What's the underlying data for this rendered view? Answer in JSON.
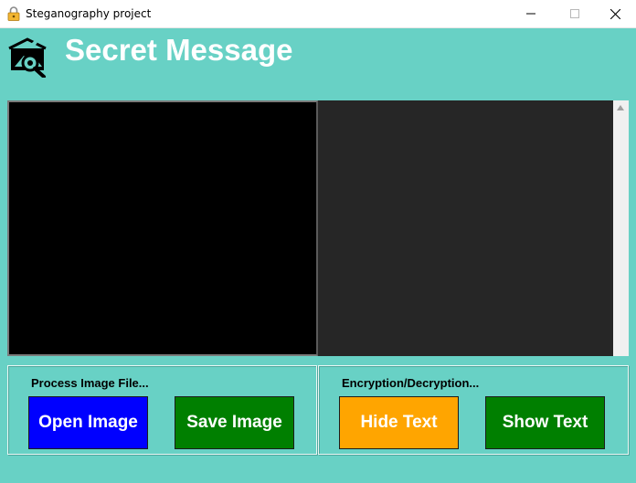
{
  "window": {
    "title": "Steganography project",
    "icons": {
      "app": "lock-icon",
      "minimize": "minimize-icon",
      "maximize": "maximize-icon",
      "close": "close-icon"
    }
  },
  "header": {
    "logo_icon": "image-search-icon",
    "heading": "Secret Message"
  },
  "image_panel": {
    "background": "#000000"
  },
  "text_area": {
    "value": "",
    "background": "#262626"
  },
  "process_frame": {
    "label": "Process Image File...",
    "open_label": "Open Image",
    "save_label": "Save Image"
  },
  "crypto_frame": {
    "label": "Encryption/Decryption...",
    "hide_label": "Hide Text",
    "show_label": "Show Text"
  },
  "colors": {
    "window_bg": "#68d1c5",
    "open_button": "#0000ff",
    "save_button": "#007f00",
    "hide_button": "#ffa500",
    "show_button": "#007f00"
  }
}
